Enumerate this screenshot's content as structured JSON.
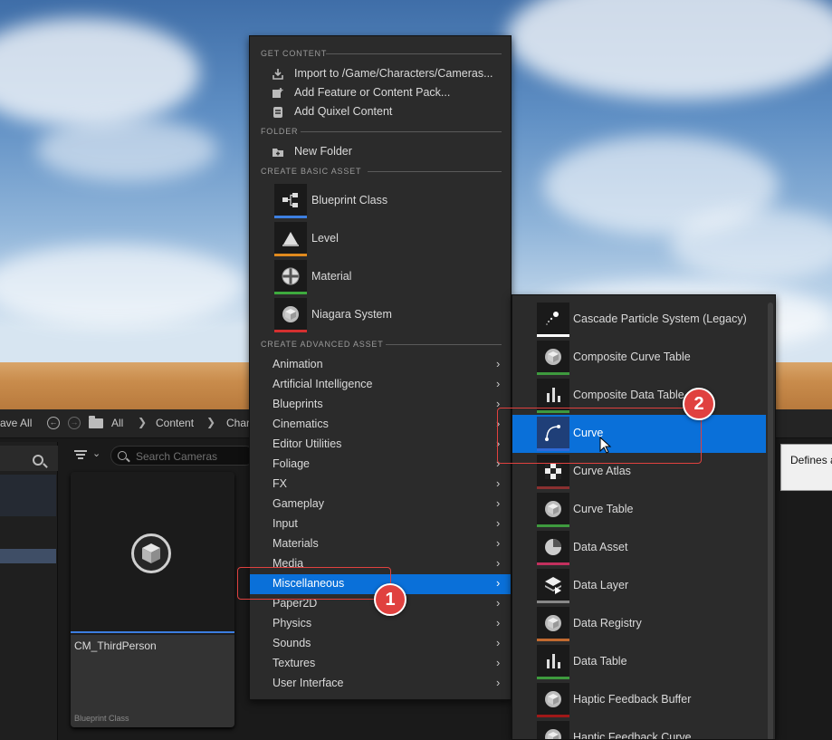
{
  "toolbar": {
    "save_all": "ave All",
    "crumb_all": "All",
    "crumb_content": "Content",
    "crumb_char": "Char"
  },
  "search": {
    "placeholder": "Search Cameras"
  },
  "asset": {
    "name": "CM_ThirdPerson",
    "type": "Blueprint Class"
  },
  "tooltip": {
    "text": "Defines a"
  },
  "menu": {
    "get_content_head": "GET CONTENT",
    "get_content": [
      {
        "label": "Import to /Game/Characters/Cameras...",
        "icon": "import-icon"
      },
      {
        "label": "Add Feature or Content Pack...",
        "icon": "feature-pack-icon"
      },
      {
        "label": "Add Quixel Content",
        "icon": "quixel-icon"
      }
    ],
    "folder_head": "FOLDER",
    "new_folder": "New Folder",
    "basic_head": "CREATE BASIC ASSET",
    "basic": [
      {
        "label": "Blueprint Class",
        "color": "#3d7fe0",
        "icon": "blueprint-icon"
      },
      {
        "label": "Level",
        "color": "#e08a1e",
        "icon": "level-icon"
      },
      {
        "label": "Material",
        "color": "#3eaa3e",
        "icon": "material-icon"
      },
      {
        "label": "Niagara System",
        "color": "#d43030",
        "icon": "niagara-icon"
      }
    ],
    "advanced_head": "CREATE ADVANCED ASSET",
    "advanced": [
      "Animation",
      "Artificial Intelligence",
      "Blueprints",
      "Cinematics",
      "Editor Utilities",
      "Foliage",
      "FX",
      "Gameplay",
      "Input",
      "Materials",
      "Media",
      "Miscellaneous",
      "Paper2D",
      "Physics",
      "Sounds",
      "Textures",
      "User Interface"
    ],
    "selected": "Miscellaneous"
  },
  "submenu": {
    "items": [
      {
        "label": "Cascade Particle System (Legacy)",
        "color": "#ffffff",
        "icon": "particle-icon"
      },
      {
        "label": "Composite Curve Table",
        "color": "#3e9a3e",
        "icon": "cube-icon"
      },
      {
        "label": "Composite Data Table",
        "color": "#3e9a3e",
        "icon": "bars-icon"
      },
      {
        "label": "Curve",
        "color": "#2f6ad8",
        "icon": "curve-icon"
      },
      {
        "label": "Curve Atlas",
        "color": "#8a3030",
        "icon": "checker-icon"
      },
      {
        "label": "Curve Table",
        "color": "#3e9a3e",
        "icon": "cube-icon"
      },
      {
        "label": "Data Asset",
        "color": "#c2305e",
        "icon": "pie-icon"
      },
      {
        "label": "Data Layer",
        "color": "#888888",
        "icon": "layer-icon"
      },
      {
        "label": "Data Registry",
        "color": "#c26a30",
        "icon": "cube-icon"
      },
      {
        "label": "Data Table",
        "color": "#3e9a3e",
        "icon": "bars-icon"
      },
      {
        "label": "Haptic Feedback Buffer",
        "color": "#a01818",
        "icon": "cube-icon"
      },
      {
        "label": "Haptic Feedback Curve",
        "color": "#a01818",
        "icon": "cube-icon"
      }
    ],
    "selected": "Curve"
  },
  "annotations": {
    "badge1": "1",
    "badge2": "2",
    "color": "#e0413f"
  }
}
